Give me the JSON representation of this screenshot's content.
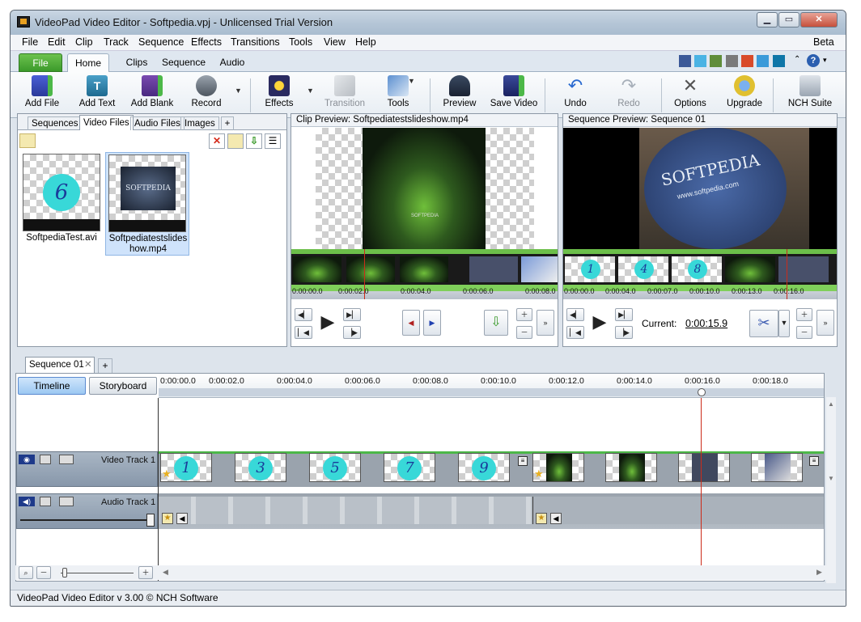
{
  "window": {
    "title": "VideoPad Video Editor - Softpedia.vpj - Unlicensed Trial Version"
  },
  "menu": [
    "File",
    "Edit",
    "Clip",
    "Track",
    "Sequence",
    "Effects",
    "Transitions",
    "Tools",
    "View",
    "Help"
  ],
  "menu_right": "Beta",
  "ribbon_tabs": [
    "File",
    "Home",
    "Clips",
    "Sequence",
    "Audio"
  ],
  "toolbar": {
    "add_file": "Add File",
    "add_text": "Add Text",
    "add_blank": "Add Blank",
    "record": "Record",
    "effects": "Effects",
    "transition": "Transition",
    "tools": "Tools",
    "preview": "Preview",
    "save_video": "Save Video",
    "undo": "Undo",
    "redo": "Redo",
    "options": "Options",
    "upgrade": "Upgrade",
    "nch_suite": "NCH Suite"
  },
  "bin": {
    "tabs": [
      "Sequences",
      "Video Files",
      "Audio Files",
      "Images",
      "+"
    ],
    "files": [
      {
        "name": "SoftpediaTest.avi",
        "thumb_text": "6"
      },
      {
        "name": "Softpediatestslideshow.mp4",
        "thumb_text": "SOFTPEDIA"
      }
    ]
  },
  "clip_preview": {
    "title": "Clip Preview: Softpediatestslideshow.mp4",
    "watermark": "SOFTPEDIA",
    "ticks": [
      "0:00:00.0",
      "0:00:02.0",
      "0:00:04.0",
      "0:00:06.0",
      "0:00:08.0"
    ]
  },
  "sequence_preview": {
    "title": "Sequence Preview: Sequence 01",
    "logo": "SOFTPEDIA",
    "logo_url": "www.softpedia.com",
    "ticks": [
      "0:00:00.0",
      "0:00:04.0",
      "0:00:07.0",
      "0:00:10.0",
      "0:00:13.0",
      "0:00:16.0"
    ],
    "strip_numbers": [
      "1",
      "4",
      "8"
    ],
    "current_label": "Current:",
    "current_value": "0:00:15.9"
  },
  "sequence_tabs": [
    "Sequence 01",
    "+"
  ],
  "view_buttons": {
    "timeline": "Timeline",
    "storyboard": "Storyboard"
  },
  "timeline_ticks": [
    "0:00:00.0",
    "0:00:02.0",
    "0:00:04.0",
    "0:00:06.0",
    "0:00:08.0",
    "0:00:10.0",
    "0:00:12.0",
    "0:00:14.0",
    "0:00:16.0",
    "0:00:18.0"
  ],
  "tracks": {
    "video": {
      "label": "Video Track 1",
      "clip_numbers": [
        "1",
        "3",
        "5",
        "7",
        "9"
      ]
    },
    "audio": {
      "label": "Audio Track 1"
    }
  },
  "status": "VideoPad Video Editor v 3.00 © NCH Software",
  "colors": {
    "accent_green": "#4fa83a",
    "playhead": "#cc2b1a",
    "ball": "#38d8d8",
    "title_bar": "#b4c5d6"
  }
}
